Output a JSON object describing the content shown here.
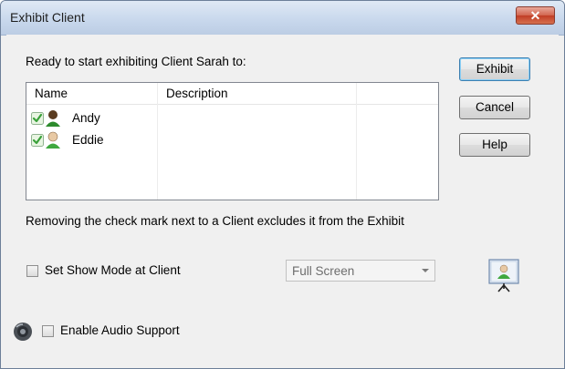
{
  "window": {
    "title": "Exhibit Client",
    "close_glyph": "✕"
  },
  "intro_text": "Ready to start exhibiting Client Sarah to:",
  "list": {
    "columns": [
      "Name",
      "Description"
    ],
    "rows": [
      {
        "name": "Andy",
        "description": "",
        "checked": true,
        "icon": "user-dark-icon"
      },
      {
        "name": "Eddie",
        "description": "",
        "checked": true,
        "icon": "user-light-icon"
      }
    ]
  },
  "buttons": {
    "exhibit": "Exhibit",
    "cancel": "Cancel",
    "help": "Help"
  },
  "note_text": "Removing the check mark next to a Client excludes it from the Exhibit",
  "show_mode": {
    "label": "Set Show Mode at Client",
    "checked": false,
    "selected": "Full Screen"
  },
  "audio": {
    "label": "Enable Audio Support",
    "checked": false
  },
  "colors": {
    "accent": "#3c7fb1",
    "close": "#c13d25",
    "check": "#3aa13a"
  }
}
